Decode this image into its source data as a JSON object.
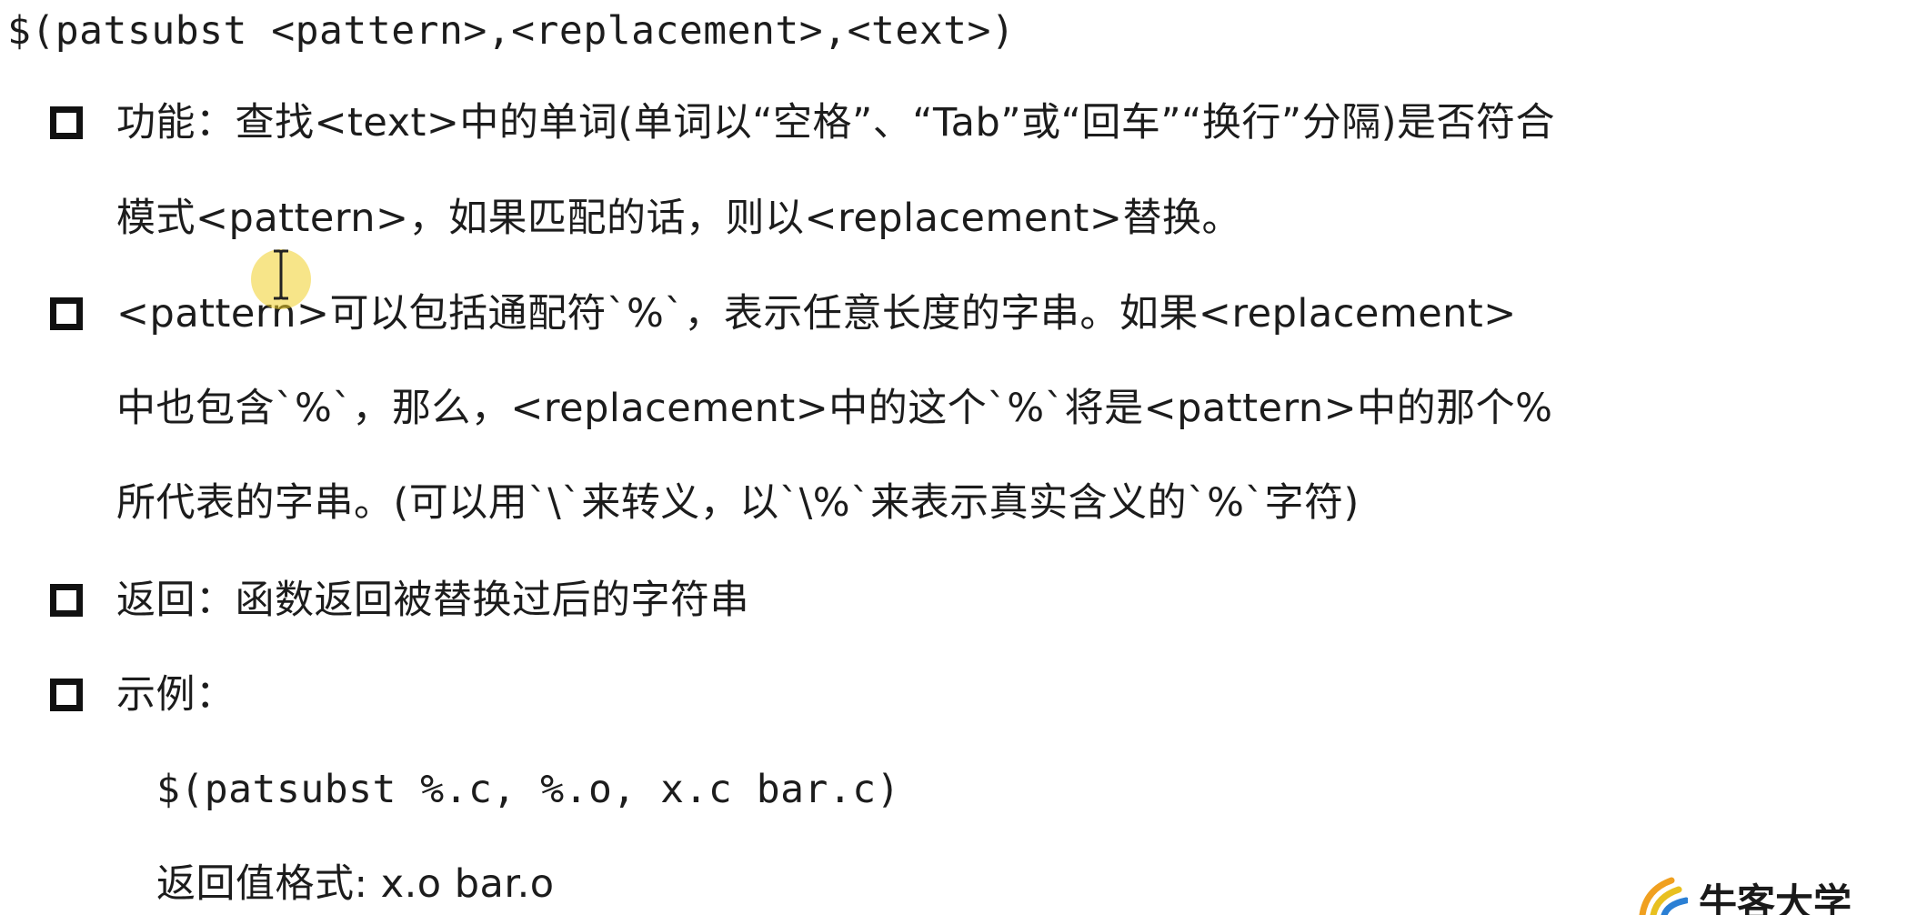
{
  "heading": "$(patsubst <pattern>,<replacement>,<text>)",
  "bullets": [
    {
      "lines": [
        "功能：查找<text>中的单词(单词以“空格”、“Tab”或“回车”“换行”分隔)是否符合",
        "模式<pattern>，如果匹配的话，则以<replacement>替换。"
      ]
    },
    {
      "lines": [
        "<pattern>可以包括通配符`%`，表示任意长度的字串。如果<replacement>",
        "中也包含`%`，那么，<replacement>中的这个`%`将是<pattern>中的那个%",
        "所代表的字串。(可以用`\\`来转义，以`\\%`来表示真实含义的`%`字符)"
      ]
    },
    {
      "lines": [
        "返回：函数返回被替换过后的字符串"
      ]
    },
    {
      "lines": [
        "示例："
      ]
    }
  ],
  "example": {
    "code": "$(patsubst %.c, %.o, x.c bar.c)",
    "result": "返回值格式: x.o bar.o"
  },
  "logo": {
    "text": "牛客大学",
    "colors": [
      "#f0a020",
      "#2a7fd4",
      "#e8c020"
    ]
  },
  "cursor": {
    "icon": "text-cursor-icon",
    "highlight_color": "#f0d028"
  }
}
